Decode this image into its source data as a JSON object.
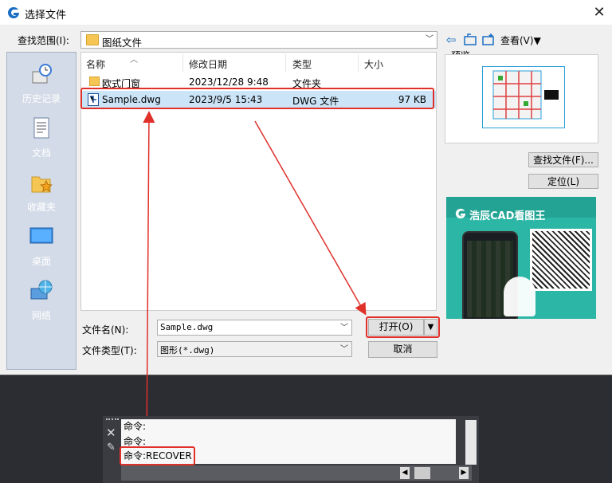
{
  "dialog": {
    "title": "选择文件",
    "close_label": "✕",
    "look_in_label": "查找范围(I):",
    "look_in_value": "图纸文件",
    "view_label": "查看(V)▼",
    "preview_label": "预览",
    "find_file_label": "查找文件(F)...",
    "locate_label": "定位(L)",
    "file_name_label": "文件名(N):",
    "file_name_value": "Sample.dwg",
    "file_type_label": "文件类型(T):",
    "file_type_value": "图形(*.dwg)",
    "open_label": "打开(O)",
    "cancel_label": "取消"
  },
  "places": [
    {
      "label": "历史记录",
      "icon": "history-icon"
    },
    {
      "label": "文档",
      "icon": "documents-icon"
    },
    {
      "label": "收藏夹",
      "icon": "favorites-icon"
    },
    {
      "label": "桌面",
      "icon": "desktop-icon"
    },
    {
      "label": "网络",
      "icon": "network-icon"
    }
  ],
  "columns": {
    "name": "名称",
    "modified": "修改日期",
    "type": "类型",
    "size": "大小"
  },
  "files": [
    {
      "name": "欧式门窗",
      "modified": "2023/12/28 9:48",
      "type": "文件夹",
      "size": ""
    },
    {
      "name": "Sample.dwg",
      "modified": "2023/9/5 15:43",
      "type": "DWG 文件",
      "size": "97 KB"
    }
  ],
  "ad": {
    "brand": "浩辰CAD看图王"
  },
  "command": {
    "lines": [
      "命令:",
      "命令:",
      "命令:RECOVER"
    ]
  },
  "colors": {
    "accent": "#e0302a",
    "selection": "#cce4f7"
  }
}
